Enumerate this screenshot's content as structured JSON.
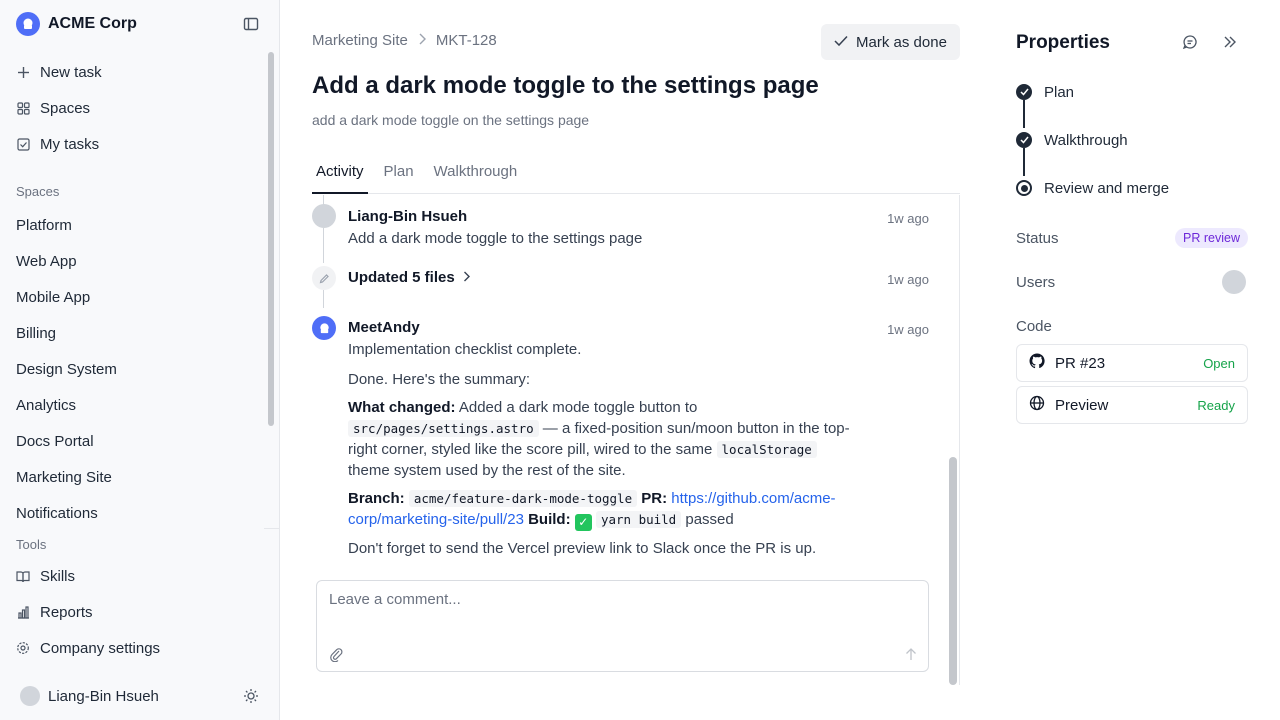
{
  "workspace": {
    "name": "ACME Corp"
  },
  "nav": [
    {
      "label": "New task",
      "icon": "plus-icon"
    },
    {
      "label": "Spaces",
      "icon": "grid-icon"
    },
    {
      "label": "My tasks",
      "icon": "checkbox-icon"
    }
  ],
  "spaces_label": "Spaces",
  "spaces": [
    "Platform",
    "Web App",
    "Mobile App",
    "Billing",
    "Design System",
    "Analytics",
    "Docs Portal",
    "Marketing Site",
    "Notifications"
  ],
  "tools_label": "Tools",
  "tools": [
    {
      "label": "Skills",
      "icon": "book-icon"
    },
    {
      "label": "Reports",
      "icon": "bar-chart-icon"
    },
    {
      "label": "Company settings",
      "icon": "gear-icon"
    }
  ],
  "current_user": "Liang-Bin Hsueh",
  "breadcrumb": {
    "space": "Marketing Site",
    "task_id": "MKT-128"
  },
  "mark_done_label": "Mark as done",
  "task": {
    "title": "Add a dark mode toggle to the settings page",
    "subtitle": "add a dark mode toggle on the settings page"
  },
  "tabs": [
    "Activity",
    "Plan",
    "Walkthrough"
  ],
  "activity": {
    "event1": {
      "author": "Liang-Bin Hsueh",
      "time": "1w ago",
      "text": "Add a dark mode toggle to the settings page"
    },
    "event2": {
      "text": "Updated 5 files",
      "time": "1w ago"
    },
    "event3": {
      "author": "MeetAndy",
      "time": "1w ago",
      "line1": "Implementation checklist complete.",
      "line2": "Done. Here's the summary:",
      "what_changed_label": "What changed:",
      "what_changed_a": "Added a dark mode toggle button to",
      "file_path": "src/pages/settings.astro",
      "what_changed_b": "— a fixed-position sun/moon button in the top-right corner, styled like the score pill, wired to the same",
      "storage_key": "localStorage",
      "what_changed_c": "theme system used by the rest of the site.",
      "branch_label": "Branch:",
      "branch": "acme/feature-dark-mode-toggle",
      "pr_label": "PR:",
      "pr_url": "https://github.com/acme-corp/marketing-site/pull/23",
      "build_label": "Build:",
      "build_cmd": "yarn build",
      "build_result": "passed",
      "reminder": "Don't forget to send the Vercel preview link to Slack once the PR is up."
    }
  },
  "comment": {
    "placeholder": "Leave a comment..."
  },
  "properties": {
    "title": "Properties",
    "steps": [
      "Plan",
      "Walkthrough",
      "Review and merge"
    ],
    "status_label": "Status",
    "status_value": "PR review",
    "users_label": "Users",
    "code_label": "Code",
    "code_items": [
      {
        "name": "PR #23",
        "state": "Open",
        "icon": "github-icon"
      },
      {
        "name": "Preview",
        "state": "Ready",
        "icon": "globe-icon"
      }
    ]
  }
}
